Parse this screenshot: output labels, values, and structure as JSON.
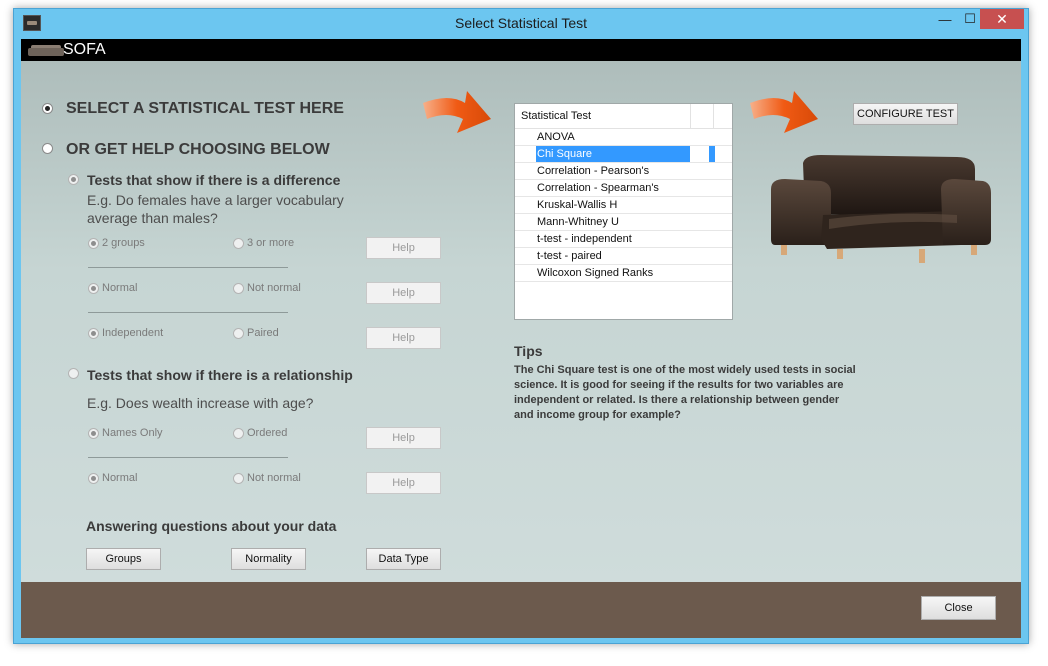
{
  "window": {
    "title": "Select Statistical Test",
    "min": "—",
    "max": "☐",
    "close": "✕"
  },
  "brand": {
    "name": "SOFA"
  },
  "options": {
    "select_here": "SELECT A STATISTICAL TEST HERE",
    "get_help": "OR GET HELP CHOOSING BELOW"
  },
  "difference": {
    "title": "Tests that show if there is a difference",
    "example_line1": "E.g. Do females have a larger vocabulary",
    "example_line2": "average than males?",
    "groups_a": "2 groups",
    "groups_b": "3 or more",
    "normal_a": "Normal",
    "normal_b": "Not normal",
    "indep_a": "Independent",
    "indep_b": "Paired"
  },
  "relationship": {
    "title": "Tests that show if there is a relationship",
    "example": "E.g. Does wealth increase with age?",
    "names_a": "Names Only",
    "names_b": "Ordered",
    "normal_a": "Normal",
    "normal_b": "Not normal"
  },
  "help_label": "Help",
  "answering": {
    "title": "Answering questions about your data",
    "groups": "Groups",
    "normality": "Normality",
    "data_type": "Data Type"
  },
  "test_list": {
    "header": "Statistical Test",
    "items": [
      "ANOVA",
      "Chi Square",
      "Correlation - Pearson's",
      "Correlation - Spearman's",
      "Kruskal-Wallis H",
      "Mann-Whitney U",
      "t-test - independent",
      "t-test - paired",
      "Wilcoxon Signed Ranks"
    ],
    "selected": "Chi Square"
  },
  "configure_button": "CONFIGURE TEST",
  "tips": {
    "title": "Tips",
    "text": "The Chi Square test is one of the most widely used tests in social science. It is good for seeing if the results for two variables are independent or related. Is there a relationship between gender and income group for example?"
  },
  "close_button": "Close",
  "colors": {
    "footer": "#6c5a4d",
    "selection": "#3399ff",
    "arrow": "#f05a14"
  }
}
